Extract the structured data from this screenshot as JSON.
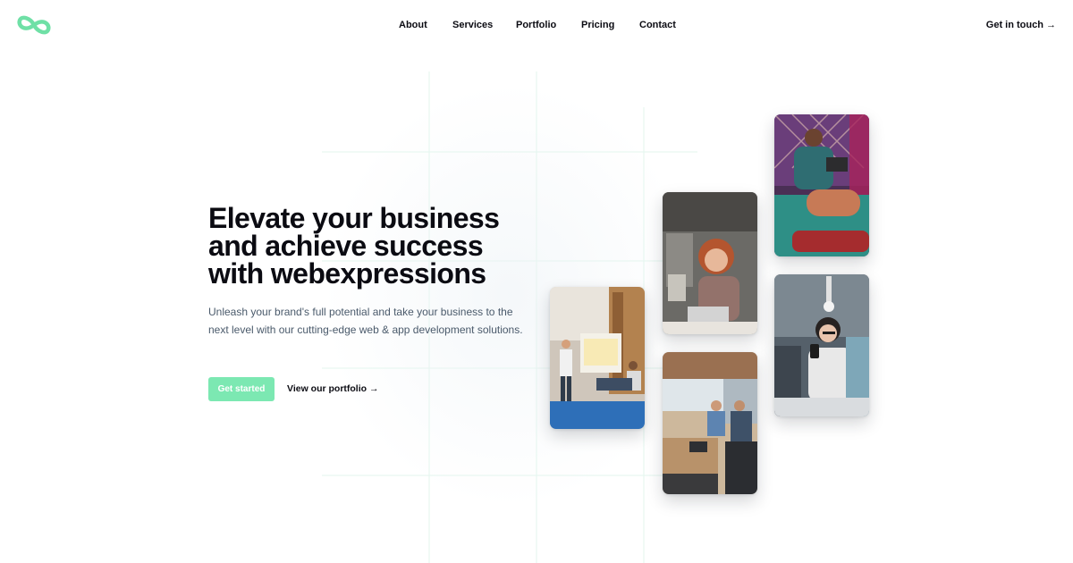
{
  "header": {
    "logo_icon": "infinity-logo-icon",
    "nav": [
      "About",
      "Services",
      "Portfolio",
      "Pricing",
      "Contact"
    ],
    "cta": "Get in touch →"
  },
  "hero": {
    "title_line1": "Elevate your business",
    "title_line2": "and achieve success",
    "title_line3": "with webexpressions",
    "subtitle": "Unleash your brand's full potential and take your business to the next level with our cutting-edge web & app development solutions.",
    "primary_button": "Get started",
    "secondary_link": "View our portfolio →"
  },
  "gallery": {
    "photos": [
      "team-presentation-photo",
      "woman-laptop-photo",
      "office-meeting-photo",
      "man-tablet-photo",
      "woman-phone-photo"
    ]
  },
  "colors": {
    "accent": "#7ce8b2",
    "text": "#0b0b12",
    "muted": "#4a5a6b"
  }
}
